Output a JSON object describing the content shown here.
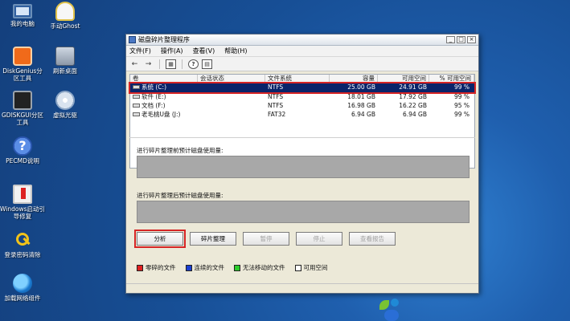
{
  "desktop": {
    "icons": [
      {
        "label": "我的电脑",
        "icon": "computer-icon"
      },
      {
        "label": "手动Ghost",
        "icon": "ghost-icon"
      },
      {
        "label": "DiskGenius分区工具",
        "icon": "diskgenius-icon"
      },
      {
        "label": "刷新桌面",
        "icon": "refresh-icon"
      },
      {
        "label": "GDISKGUI分区工具",
        "icon": "gdisk-icon"
      },
      {
        "label": "虚拟光驱",
        "icon": "cd-icon"
      },
      {
        "label": "PECMD说明",
        "icon": "help-icon"
      },
      {
        "label": "Windows启动引导修复",
        "icon": "boot-repair-icon"
      },
      {
        "label": "登录密码清除",
        "icon": "key-icon"
      },
      {
        "label": "加载网络组件",
        "icon": "network-icon"
      }
    ]
  },
  "window": {
    "title": "磁盘碎片整理程序",
    "controls": {
      "minimize": "_",
      "maximize": "□",
      "close": "×"
    },
    "menu": [
      "文件(F)",
      "操作(A)",
      "查看(V)",
      "帮助(H)"
    ],
    "list": {
      "headers": [
        "卷",
        "会话状态",
        "文件系统",
        "容量",
        "可用空间",
        "% 可用空间"
      ],
      "rows": [
        {
          "volume": "系统 (C:)",
          "status": "",
          "fs": "NTFS",
          "capacity": "25.00 GB",
          "free": "24.91 GB",
          "pct": "99 %"
        },
        {
          "volume": "软件 (E:)",
          "status": "",
          "fs": "NTFS",
          "capacity": "18.01 GB",
          "free": "17.92 GB",
          "pct": "99 %"
        },
        {
          "volume": "文档 (F:)",
          "status": "",
          "fs": "NTFS",
          "capacity": "16.98 GB",
          "free": "16.22 GB",
          "pct": "95 %"
        },
        {
          "volume": "老毛桃U盘 (J:)",
          "status": "",
          "fs": "FAT32",
          "capacity": "6.94 GB",
          "free": "6.94 GB",
          "pct": "99 %"
        }
      ]
    },
    "before_label": "进行碎片整理前预计磁盘使用量:",
    "after_label": "进行碎片整理后预计磁盘使用量:",
    "buttons": {
      "analyze": "分析",
      "defrag": "碎片整理",
      "pause": "暂停",
      "stop": "停止",
      "report": "查看报告"
    },
    "legend": [
      {
        "label": "零碎的文件",
        "color": "#e02020"
      },
      {
        "label": "连续的文件",
        "color": "#1a3fd1"
      },
      {
        "label": "无法移动的文件",
        "color": "#2ccc2c"
      },
      {
        "label": "可用空间",
        "color": "#ffffff"
      }
    ]
  }
}
